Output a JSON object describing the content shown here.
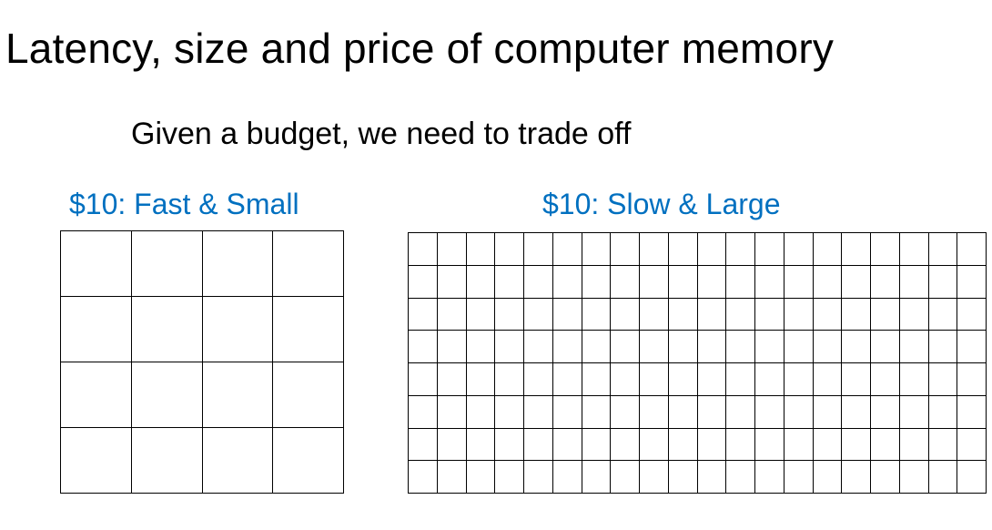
{
  "title": "Latency, size and price of computer memory",
  "subtitle": "Given a budget, we need to trade off",
  "accent_color": "#0070C0",
  "left": {
    "label": "$10: Fast & Small",
    "rows": 4,
    "cols": 4
  },
  "right": {
    "label": "$10: Slow & Large",
    "rows": 8,
    "cols": 20
  }
}
